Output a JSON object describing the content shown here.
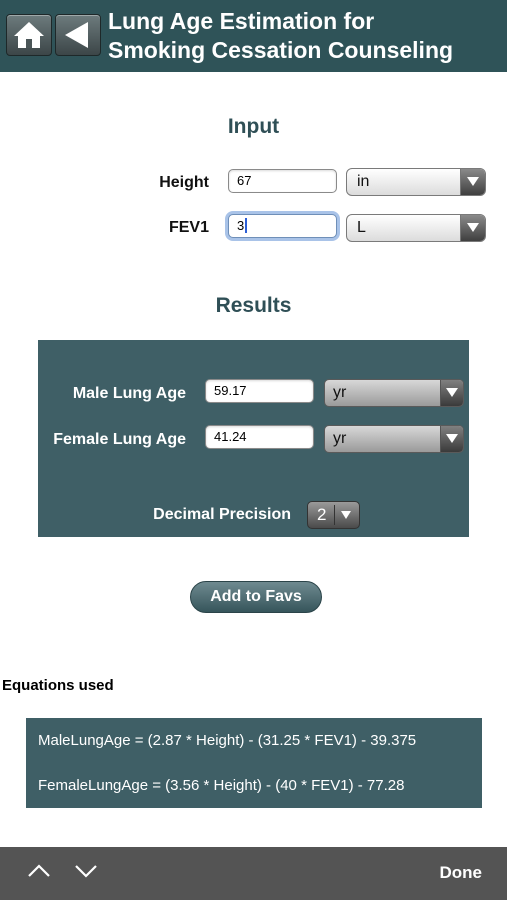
{
  "header": {
    "title_line1": "Lung Age Estimation for",
    "title_line2": "Smoking Cessation Counseling",
    "home_icon": "home-icon",
    "back_icon": "back-arrow-icon"
  },
  "input": {
    "heading": "Input",
    "height": {
      "label": "Height",
      "value": "67",
      "unit": "in"
    },
    "fev1": {
      "label": "FEV1",
      "value": "3",
      "unit": "L"
    }
  },
  "results": {
    "heading": "Results",
    "male": {
      "label": "Male Lung Age",
      "value": "59.17",
      "unit": "yr"
    },
    "female": {
      "label": "Female Lung Age",
      "value": "41.24",
      "unit": "yr"
    },
    "precision": {
      "label": "Decimal Precision",
      "value": "2"
    }
  },
  "favs_button": "Add to Favs",
  "equations": {
    "heading": "Equations used",
    "male": "MaleLungAge = (2.87 * Height) - (31.25 * FEV1) - 39.375",
    "female": "FemaleLungAge = (3.56 * Height) - (40 * FEV1) - 77.28"
  },
  "toolbar": {
    "prev_icon": "chevron-up-icon",
    "next_icon": "chevron-down-icon",
    "done_label": "Done"
  },
  "colors": {
    "header_bg": "#2f5358",
    "panel_bg": "#3f5f66",
    "heading_text": "#2f4f56",
    "toolbar_bg": "#545454"
  }
}
